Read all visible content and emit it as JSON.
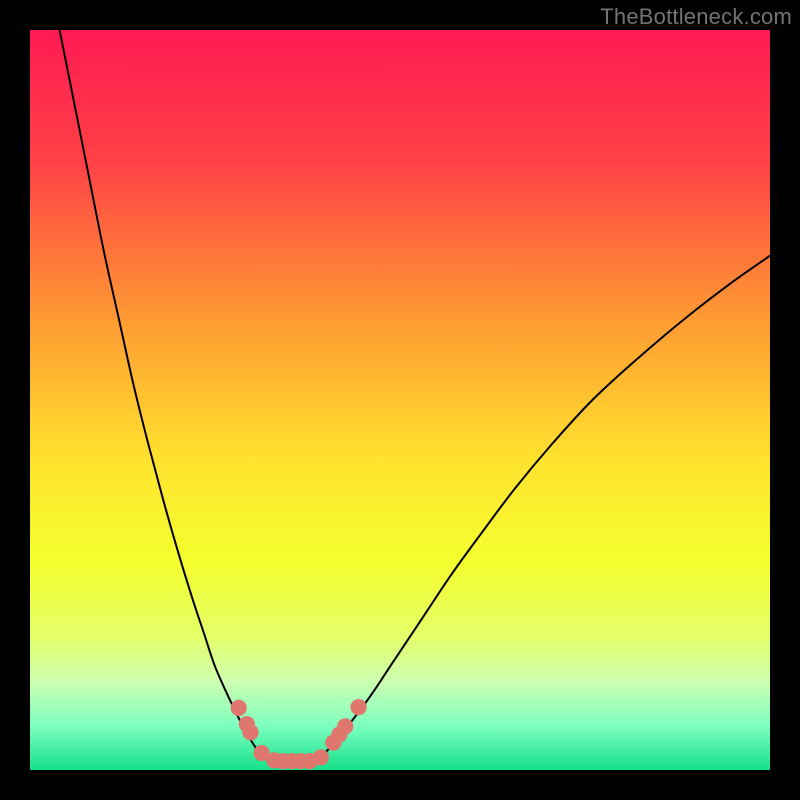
{
  "watermark": "TheBottleneck.com",
  "chart_data": {
    "type": "line",
    "title": "",
    "xlabel": "",
    "ylabel": "",
    "xlim": [
      0,
      100
    ],
    "ylim": [
      0,
      100
    ],
    "legend": null,
    "background_gradient_stops": [
      {
        "offset": 0,
        "color": "#ff1a52"
      },
      {
        "offset": 0.18,
        "color": "#ff4246"
      },
      {
        "offset": 0.4,
        "color": "#ff9e32"
      },
      {
        "offset": 0.58,
        "color": "#ffe22e"
      },
      {
        "offset": 0.72,
        "color": "#f4ff2e"
      },
      {
        "offset": 0.82,
        "color": "#e4ff6a"
      },
      {
        "offset": 0.88,
        "color": "#cdffb0"
      },
      {
        "offset": 0.94,
        "color": "#7effc0"
      },
      {
        "offset": 1.0,
        "color": "#14e08a"
      }
    ],
    "series": [
      {
        "name": "left-branch",
        "x": [
          4.0,
          6.0,
          8.0,
          10.0,
          12.0,
          14.0,
          16.0,
          18.0,
          20.0,
          22.0,
          23.5,
          25.0,
          27.0,
          29.0,
          30.5,
          31.5
        ],
        "y": [
          100,
          90,
          80,
          70,
          61,
          52,
          44,
          36.5,
          29.5,
          23,
          18.5,
          14,
          9.5,
          5.5,
          3.0,
          1.5
        ],
        "stroke": "#000000",
        "stroke_width": 2
      },
      {
        "name": "valley-floor",
        "x": [
          31.5,
          34.0,
          36.5,
          39.0
        ],
        "y": [
          1.5,
          1.2,
          1.2,
          1.5
        ],
        "stroke": "#000000",
        "stroke_width": 2
      },
      {
        "name": "right-branch",
        "x": [
          39.0,
          41.0,
          43.0,
          46.0,
          49.0,
          53.0,
          57.0,
          61.0,
          65.5,
          70.5,
          76.0,
          82.0,
          88.5,
          95.0,
          100.0
        ],
        "y": [
          1.5,
          3.5,
          6.0,
          10.0,
          14.5,
          20.5,
          26.5,
          32.0,
          38.0,
          44.0,
          50.0,
          55.5,
          61.0,
          66.0,
          69.5
        ],
        "stroke": "#000000",
        "stroke_width": 2
      }
    ],
    "markers": [
      {
        "x": 28.2,
        "y": 8.4,
        "r": 1.1,
        "fill": "#e0776f"
      },
      {
        "x": 29.3,
        "y": 6.2,
        "r": 1.1,
        "fill": "#e0776f"
      },
      {
        "x": 29.8,
        "y": 5.1,
        "r": 1.1,
        "fill": "#e0776f"
      },
      {
        "x": 31.3,
        "y": 2.3,
        "r": 1.1,
        "fill": "#e0776f"
      },
      {
        "x": 33.0,
        "y": 1.3,
        "r": 1.1,
        "fill": "#e0776f"
      },
      {
        "x": 34.2,
        "y": 1.2,
        "r": 1.1,
        "fill": "#e0776f"
      },
      {
        "x": 35.4,
        "y": 1.2,
        "r": 1.1,
        "fill": "#e0776f"
      },
      {
        "x": 36.6,
        "y": 1.2,
        "r": 1.1,
        "fill": "#e0776f"
      },
      {
        "x": 37.8,
        "y": 1.2,
        "r": 1.1,
        "fill": "#e0776f"
      },
      {
        "x": 39.3,
        "y": 1.7,
        "r": 1.1,
        "fill": "#e0776f"
      },
      {
        "x": 41.0,
        "y": 3.7,
        "r": 1.1,
        "fill": "#e0776f"
      },
      {
        "x": 41.8,
        "y": 4.8,
        "r": 1.1,
        "fill": "#e0776f"
      },
      {
        "x": 42.6,
        "y": 5.9,
        "r": 1.1,
        "fill": "#e0776f"
      },
      {
        "x": 44.4,
        "y": 8.5,
        "r": 1.1,
        "fill": "#e0776f"
      }
    ]
  }
}
